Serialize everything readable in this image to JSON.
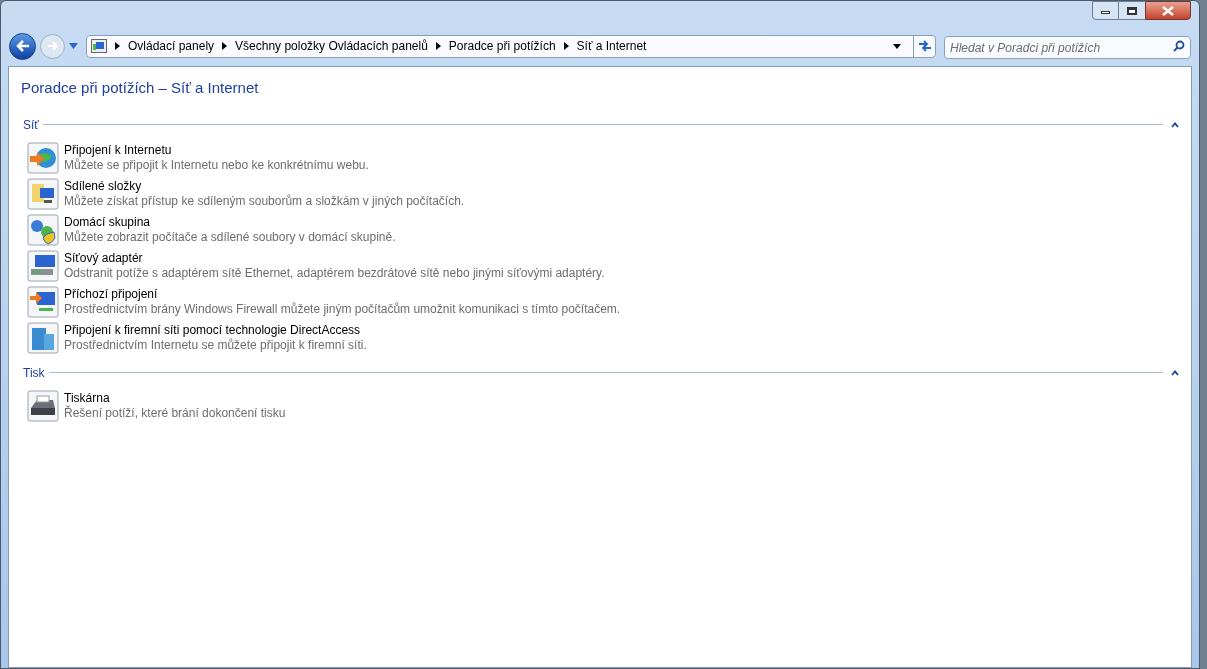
{
  "address_bar": {
    "breadcrumbs": [
      "Ovládací panely",
      "Všechny položky Ovládacích panelů",
      "Poradce při potížích",
      "Síť a Internet"
    ]
  },
  "search": {
    "placeholder": "Hledat v Poradci při potížích"
  },
  "page_title": "Poradce při potížích – Síť a Internet",
  "sections": [
    {
      "title": "Síť",
      "expanded": true,
      "items": [
        {
          "title": "Připojení k Internetu",
          "description": "Můžete se připojit k Internetu nebo ke konkrétnímu webu."
        },
        {
          "title": "Sdílené složky",
          "description": "Můžete získat přístup ke sdíleným souborům a složkám v jiných počítačích."
        },
        {
          "title": "Domácí skupina",
          "description": "Můžete zobrazit počítače a sdílené soubory v domácí skupině."
        },
        {
          "title": "Síťový adaptér",
          "description": "Odstranit potíže s adaptérem sítě Ethernet, adaptérem bezdrátové sítě nebo jinými síťovými adaptéry."
        },
        {
          "title": "Příchozí připojení",
          "description": "Prostřednictvím brány Windows Firewall můžete jiným počítačům umožnit komunikaci s tímto počítačem."
        },
        {
          "title": "Připojení k firemní síti pomocí technologie DirectAccess",
          "description": "Prostřednictvím Internetu se můžete připojit k firemní síti."
        }
      ]
    },
    {
      "title": "Tisk",
      "expanded": true,
      "items": [
        {
          "title": "Tiskárna",
          "description": "Řešení potíží, které brání dokončení tisku"
        }
      ]
    }
  ]
}
